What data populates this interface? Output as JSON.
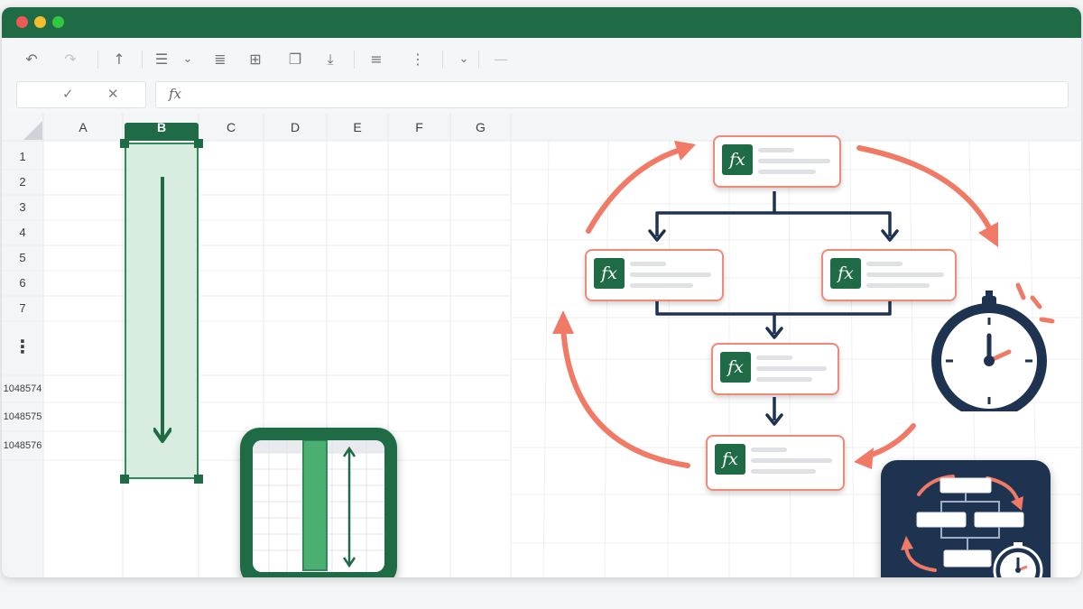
{
  "formula_bar": {
    "fx_label": "fx",
    "confirm_icon": "✓",
    "cancel_icon": "✕"
  },
  "toolbar": {
    "undo": "↶",
    "redo": "↷",
    "sort": "↑",
    "align": "☰",
    "align_menu": "⌄",
    "indent": "≣",
    "borders": "⊞",
    "copy": "❐",
    "insert": "⤓",
    "wrap": "≡",
    "list": "⋮",
    "more": "⌄",
    "overflow": "—"
  },
  "sheet": {
    "columns": [
      "A",
      "B",
      "C",
      "D",
      "E",
      "F",
      "G"
    ],
    "selected_column": "B",
    "rows": [
      "1",
      "2",
      "3",
      "4",
      "5",
      "6",
      "7"
    ],
    "ellipsis": "⋮",
    "bottom_rows": [
      "1048574",
      "1048575",
      "1048576"
    ]
  },
  "colors": {
    "brand_green": "#1e6b45",
    "selection_fill": "#dcefe2",
    "accent_coral": "#f07a66",
    "navy": "#1e3350",
    "header_bg": "#f4f5f6"
  },
  "illustrations": {
    "flow_node_icon": "fx",
    "node_count": 5,
    "widgets": [
      "column-resize-icon",
      "stopwatch-icon",
      "recalc-cycle-icon"
    ]
  }
}
